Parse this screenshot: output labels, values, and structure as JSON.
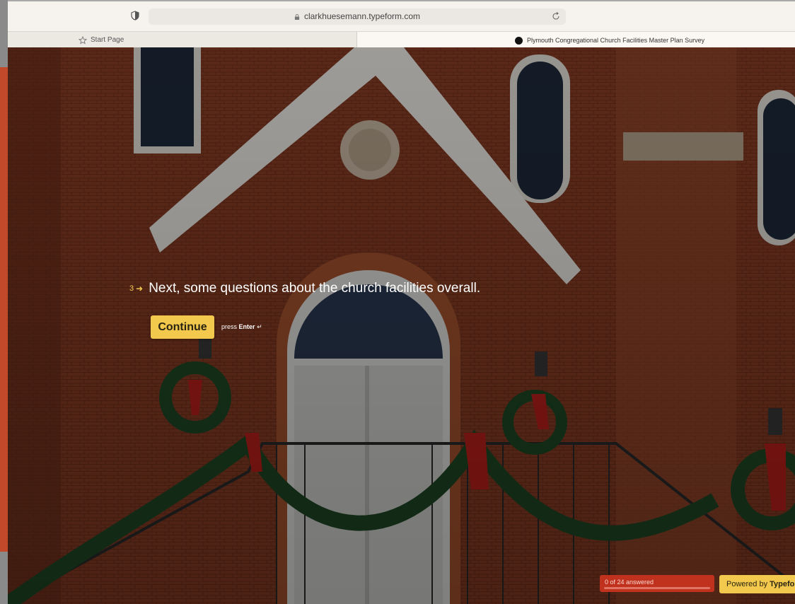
{
  "browser": {
    "url": "clarkhuesemann.typeform.com",
    "tabs": [
      {
        "label": "Start Page",
        "active": false
      },
      {
        "label": "Plymouth Congregational Church Facilities Master Plan Survey",
        "active": true
      }
    ]
  },
  "question": {
    "number": "3",
    "text": "Next, some questions about the church facilities overall."
  },
  "continue_button": {
    "label": "Continue"
  },
  "hint": {
    "prefix": "press",
    "key": "Enter",
    "symbol": "↵"
  },
  "progress": {
    "label": "0 of 24 answered",
    "answered": 0,
    "total": 24
  },
  "branding": {
    "prefix": "Powered by",
    "brand": "Typeform"
  },
  "colors": {
    "accent": "#f2c94c",
    "progress": "#c0321e",
    "overlay_text": "#ffffff"
  },
  "icons": [
    "shield-icon",
    "lock-icon",
    "reload-icon",
    "star-icon",
    "tab-favicon",
    "arrow-right-icon",
    "enter-key-icon"
  ]
}
